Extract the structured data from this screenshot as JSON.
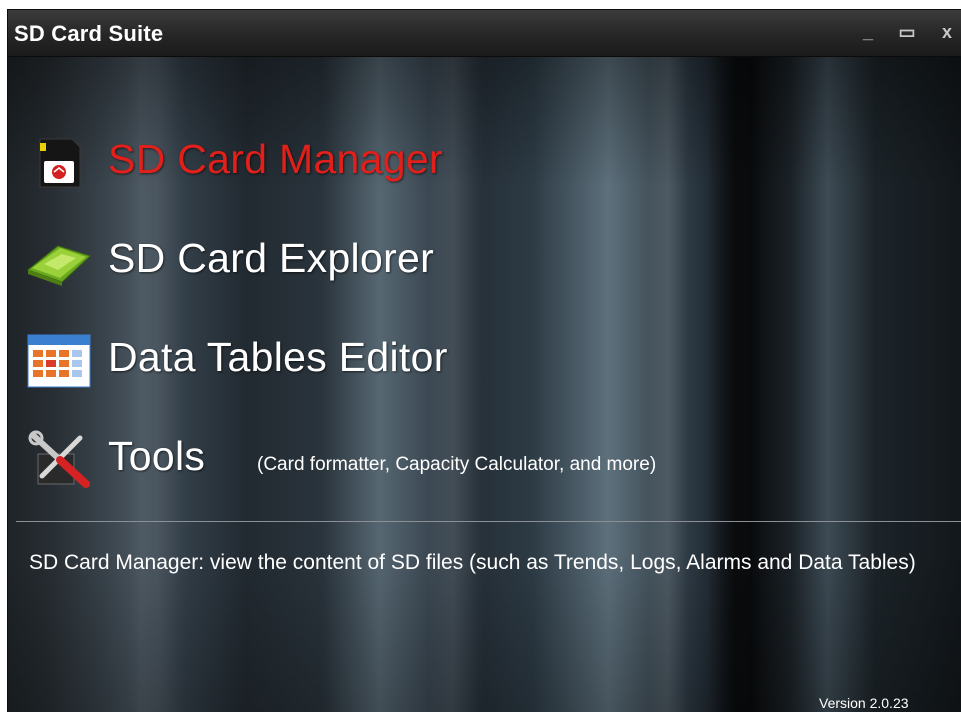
{
  "window": {
    "title": "SD Card Suite",
    "controls": {
      "minimize": "_",
      "maximize": "▭",
      "close": "x"
    }
  },
  "menu": [
    {
      "label": "SD Card Manager",
      "icon": "sd-card-icon",
      "active": true,
      "subtitle": ""
    },
    {
      "label": "SD Card Explorer",
      "icon": "folder-icon",
      "active": false,
      "subtitle": ""
    },
    {
      "label": "Data Tables Editor",
      "icon": "calendar-table-icon",
      "active": false,
      "subtitle": ""
    },
    {
      "label": "Tools",
      "icon": "tools-icon",
      "active": false,
      "subtitle": "(Card formatter, Capacity Calculator,  and more)"
    }
  ],
  "description": "SD Card Manager: view the content of SD files (such as Trends, Logs, Alarms and Data Tables)",
  "version": "Version 2.0.23",
  "colors": {
    "active": "#e2201b",
    "text": "#ffffff",
    "titlebar": "#262626"
  }
}
